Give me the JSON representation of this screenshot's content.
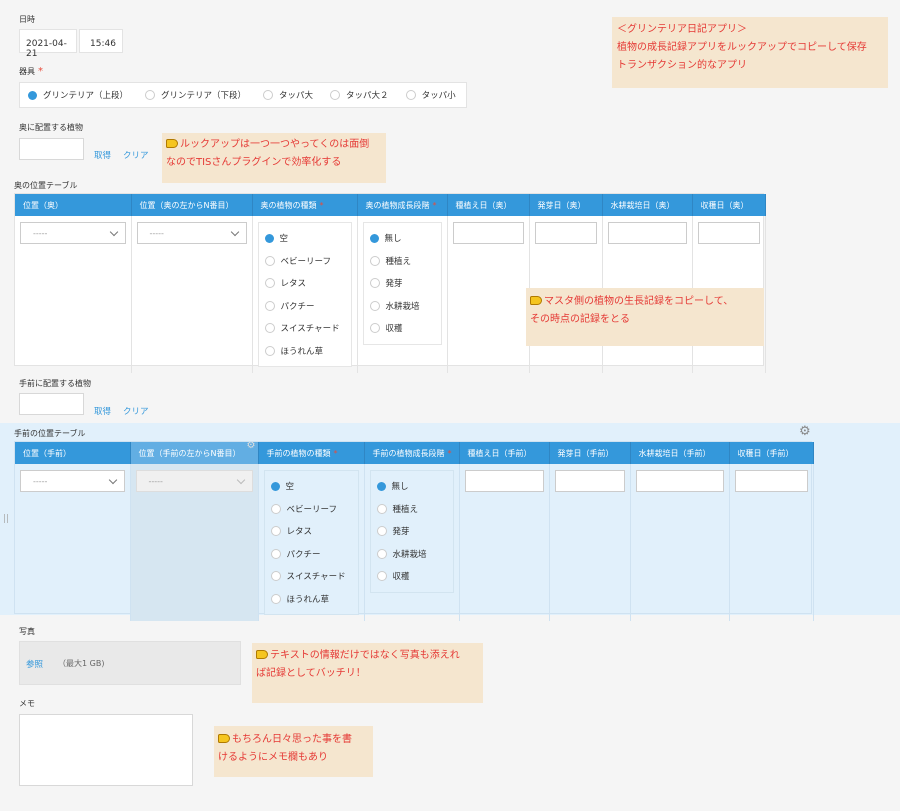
{
  "datetime": {
    "label": "日時",
    "date": "2021-04-21",
    "time": "15:46"
  },
  "equipment": {
    "label": "器具",
    "required": "*",
    "options": [
      "グリンテリア（上段）",
      "グリンテリア（下段）",
      "タッパ大",
      "タッパ大２",
      "タッパ小"
    ],
    "selected": 0
  },
  "back_plant": {
    "label": "奥に配置する植物",
    "fetch": "取得",
    "clear": "クリア"
  },
  "back_table": {
    "title": "奥の位置テーブル",
    "headers": [
      "位置（奥）",
      "位置（奥の左からN番目）",
      "奥の植物の種類",
      "奥の植物成長段階",
      "種植え日（奥）",
      "発芽日（奥）",
      "水耕栽培日（奥）",
      "収穫日（奥）"
    ],
    "required_marks": [
      "",
      "",
      "*",
      "*",
      "",
      "",
      "",
      ""
    ],
    "select_placeholder": "-----",
    "plant_types": [
      "空",
      "ベビーリーフ",
      "レタス",
      "パクチー",
      "スイスチャード",
      "ほうれん草"
    ],
    "growth_stages": [
      "無し",
      "種植え",
      "発芽",
      "水耕栽培",
      "収穫"
    ]
  },
  "front_plant": {
    "label": "手前に配置する植物",
    "fetch": "取得",
    "clear": "クリア"
  },
  "front_table": {
    "title": "手前の位置テーブル",
    "headers": [
      "位置（手前）",
      "位置（手前の左からN番目）",
      "手前の植物の種類",
      "手前の植物成長段階",
      "種植え日（手前）",
      "発芽日（手前）",
      "水耕栽培日（手前）",
      "収穫日（手前）"
    ],
    "required_marks": [
      "",
      "",
      "*",
      "*",
      "",
      "",
      "",
      ""
    ],
    "select_placeholder": "-----",
    "plant_types": [
      "空",
      "ベビーリーフ",
      "レタス",
      "パクチー",
      "スイスチャード",
      "ほうれん草"
    ],
    "growth_stages": [
      "無し",
      "種植え",
      "発芽",
      "水耕栽培",
      "収穫"
    ]
  },
  "photo": {
    "label": "写真",
    "browse": "参照",
    "max_size": "（最大1 GB)"
  },
  "memo": {
    "label": "メモ"
  },
  "notes": {
    "app": [
      "＜グリンテリア日記アプリ＞",
      "植物の成長記録アプリをルックアップでコピーして保存",
      "トランザクション的なアプリ"
    ],
    "lookup": [
      "ルックアップは一つ一つやってくのは面倒",
      "なのでTISさんプラグインで効率化する"
    ],
    "master": [
      "マスタ側の植物の生長記録をコピーして、",
      "その時点の記録をとる"
    ],
    "photo": [
      "テキストの情報だけではなく写真も添えれ",
      "ば記録としてバッチリ！"
    ],
    "memo": [
      "もちろん日々思った事を書",
      "けるようにメモ欄もあり"
    ]
  },
  "colors": {
    "header_blue": "#3498db",
    "note_bg": "#f5e6cf",
    "note_text": "#e53935",
    "front_bg": "#e1f0fb"
  }
}
